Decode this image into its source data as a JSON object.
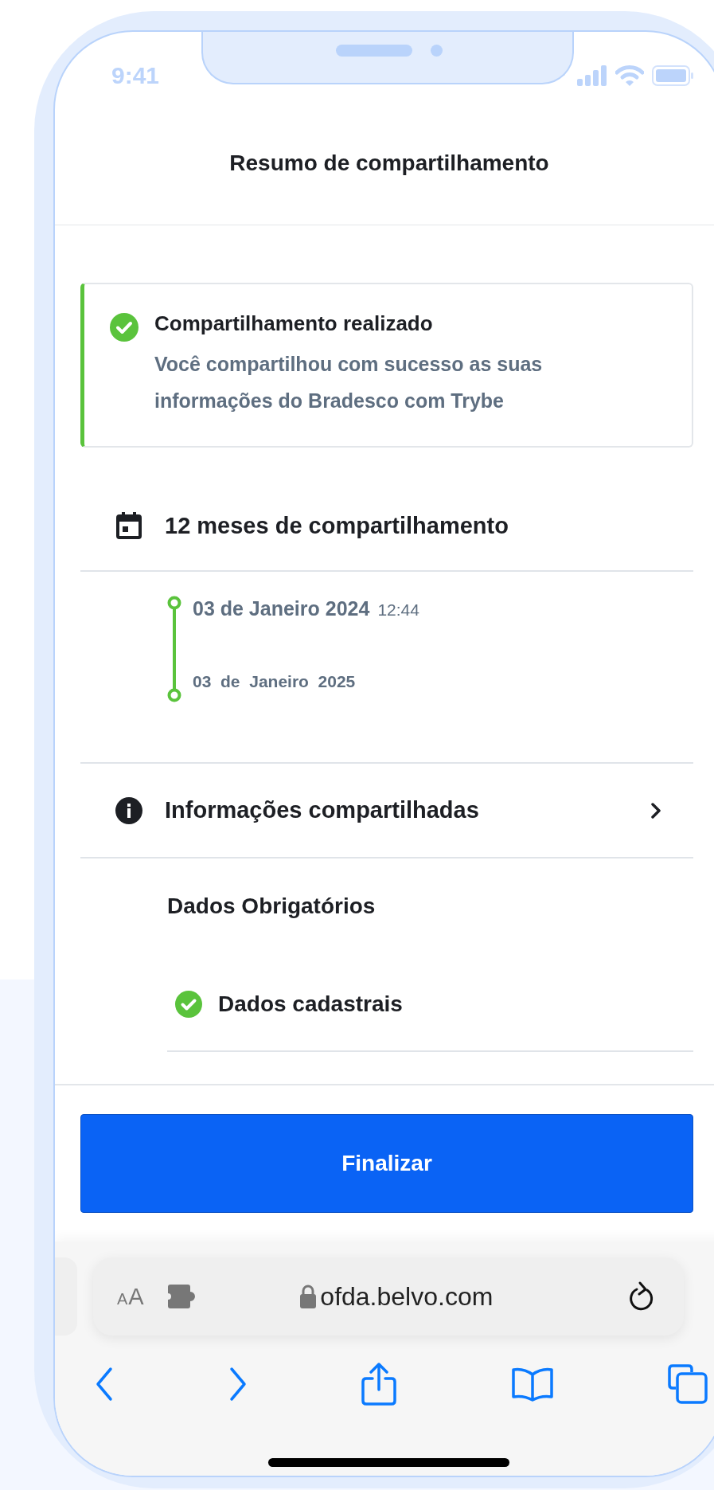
{
  "status_bar": {
    "time": "9:41"
  },
  "header": {
    "title": "Resumo de compartilhamento"
  },
  "success_card": {
    "title": "Compartilhamento realizado",
    "message": "Você compartilhou com sucesso as suas informações do Bradesco com Trybe"
  },
  "period": {
    "label": "12 meses de compartilhamento",
    "start": {
      "date": "03 de Janeiro 2024",
      "time": "12:44"
    },
    "end": {
      "date": "03  de  Janeiro  2025"
    }
  },
  "shared_info": {
    "label": "Informações compartilhadas"
  },
  "sections": [
    {
      "title": "Dados Obrigatórios",
      "items": [
        {
          "label": "Dados cadastrais",
          "checked": true
        }
      ]
    }
  ],
  "primary_button": {
    "label": "Finalizar"
  },
  "browser": {
    "text_size": {
      "small": "A",
      "large": "A"
    },
    "url": "ofda.belvo.com"
  }
}
